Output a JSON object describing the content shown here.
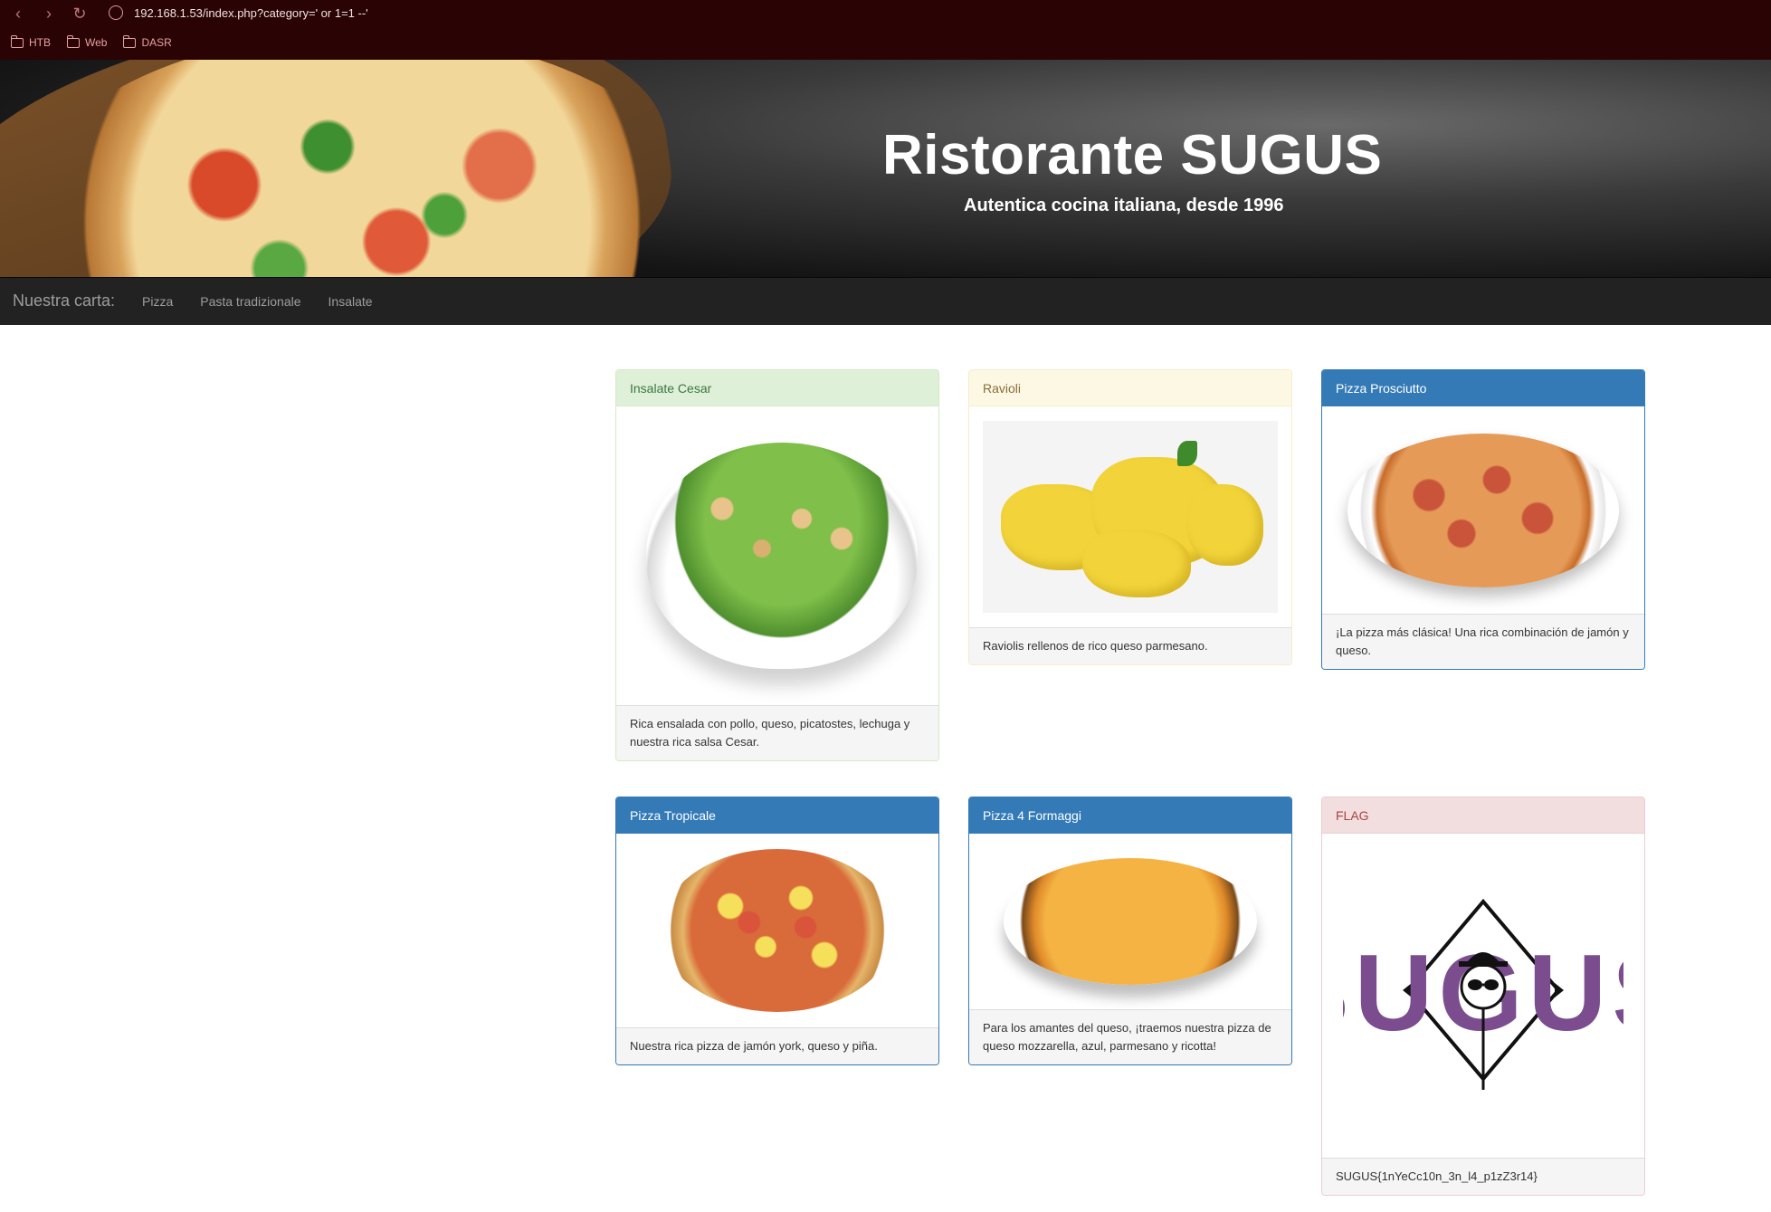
{
  "browser": {
    "url": "192.168.1.53/index.php?category=' or 1=1 --'",
    "bookmarks": [
      "HTB",
      "Web",
      "DASR"
    ]
  },
  "hero": {
    "title": "Ristorante SUGUS",
    "subtitle": "Autentica cocina italiana, desde 1996"
  },
  "navbar": {
    "brand": "Nuestra carta:",
    "links": [
      "Pizza",
      "Pasta tradizionale",
      "Insalate"
    ]
  },
  "panels": [
    {
      "title": "Insalate Cesar",
      "style": "success",
      "image": "caesar-salad-image",
      "description": "Rica ensalada con pollo, queso, picatostes, lechuga y nuestra rica salsa Cesar."
    },
    {
      "title": "Ravioli",
      "style": "warning",
      "image": "ravioli-image",
      "description": "Raviolis rellenos de rico queso parmesano."
    },
    {
      "title": "Pizza Prosciutto",
      "style": "primary",
      "image": "prosciutto-pizza-image",
      "description": "¡La pizza más clásica! Una rica combinación de jamón y queso."
    },
    {
      "title": "Pizza Tropicale",
      "style": "primary",
      "image": "tropicale-pizza-image",
      "description": "Nuestra rica pizza de jamón york, queso y piña."
    },
    {
      "title": "Pizza 4 Formaggi",
      "style": "primary",
      "image": "formaggi-pizza-image",
      "description": "Para los amantes del queso, ¡traemos nuestra pizza de queso mozzarella, azul, parmesano y ricotta!"
    },
    {
      "title": "FLAG",
      "style": "danger",
      "image": "sugus-logo-image",
      "logo_text": "SUGUS",
      "description": "SUGUS{1nYeCc10n_3n_l4_p1zZ3r14}"
    }
  ],
  "colors": {
    "browser_bg": "#2a0304",
    "navbar_bg": "#222222",
    "primary": "#337ab7",
    "logo_purple": "#7b4d8f"
  }
}
